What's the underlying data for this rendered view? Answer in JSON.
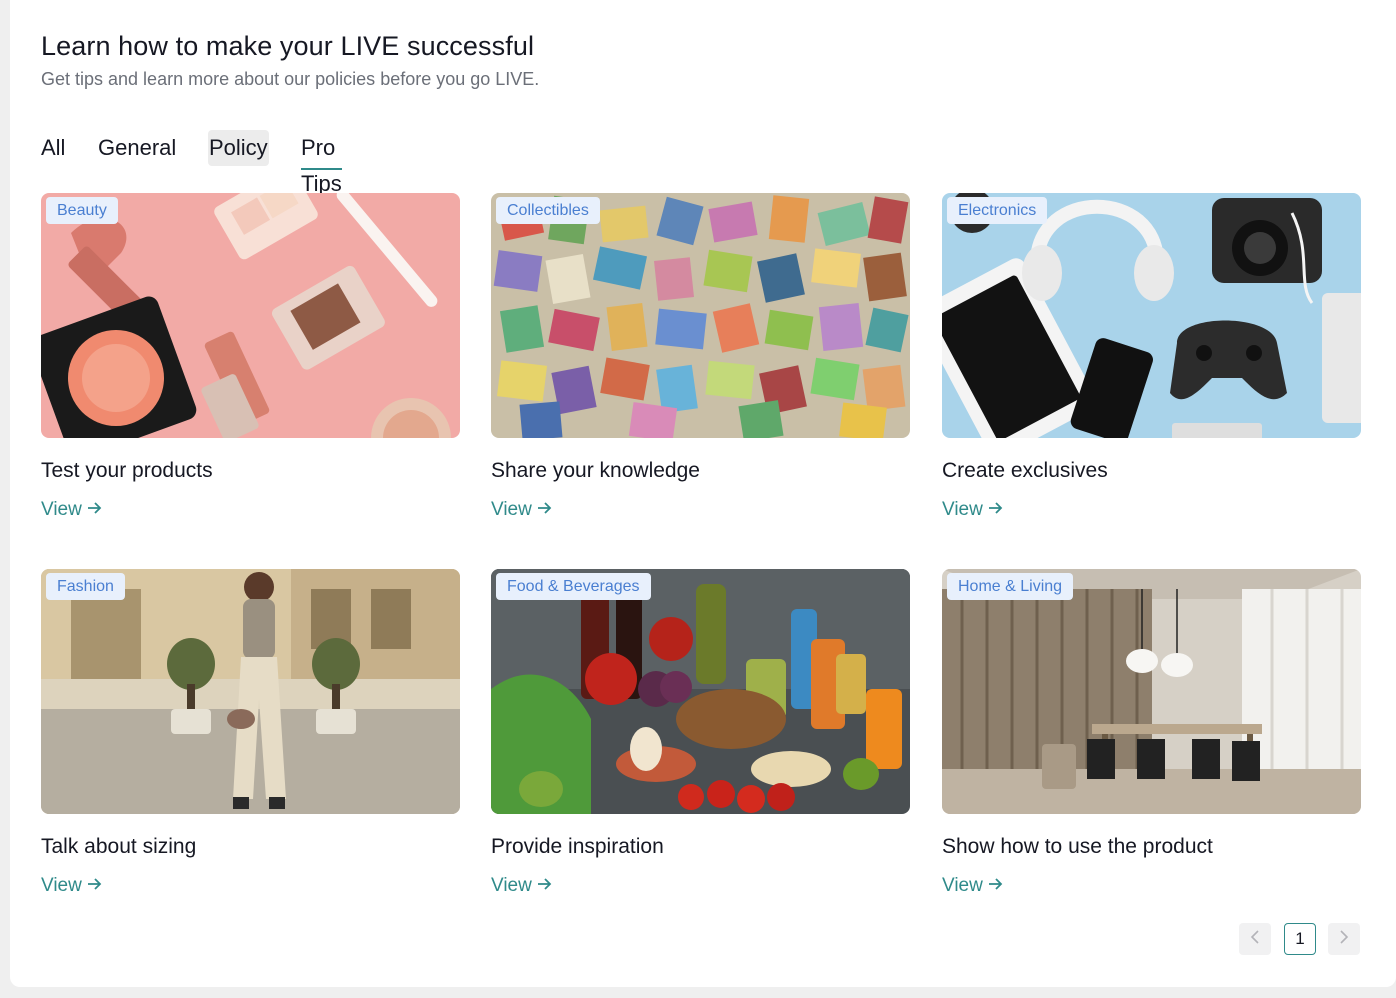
{
  "header": {
    "title": "Learn how to make your LIVE successful",
    "subtitle": "Get tips and learn more about our policies before you go LIVE."
  },
  "tabs": [
    {
      "label": "All"
    },
    {
      "label": "General"
    },
    {
      "label": "Policy",
      "state": "hover"
    },
    {
      "label": "Pro Tips",
      "state": "active"
    }
  ],
  "cards": [
    {
      "tag": "Beauty",
      "title": "Test your products",
      "link": "View",
      "image": "cosmetics-photo"
    },
    {
      "tag": "Collectibles",
      "title": "Share your knowledge",
      "link": "View",
      "image": "stamps-photo"
    },
    {
      "tag": "Electronics",
      "title": "Create exclusives",
      "link": "View",
      "image": "electronics-photo"
    },
    {
      "tag": "Fashion",
      "title": "Talk about sizing",
      "link": "View",
      "image": "fashion-photo"
    },
    {
      "tag": "Food & Beverages",
      "title": "Provide inspiration",
      "link": "View",
      "image": "food-photo"
    },
    {
      "tag": "Home & Living",
      "title": "Show how to use the product",
      "link": "View",
      "image": "interior-photo"
    }
  ],
  "pagination": {
    "current_page": "1",
    "prev_icon": "chevron-left-icon",
    "next_icon": "chevron-right-icon"
  },
  "colors": {
    "accent": "#2f8a8a",
    "tag_text": "#4a7fd1",
    "tag_bg": "#e8f0fc",
    "text_primary": "#161823",
    "text_secondary": "#6b6f78"
  }
}
